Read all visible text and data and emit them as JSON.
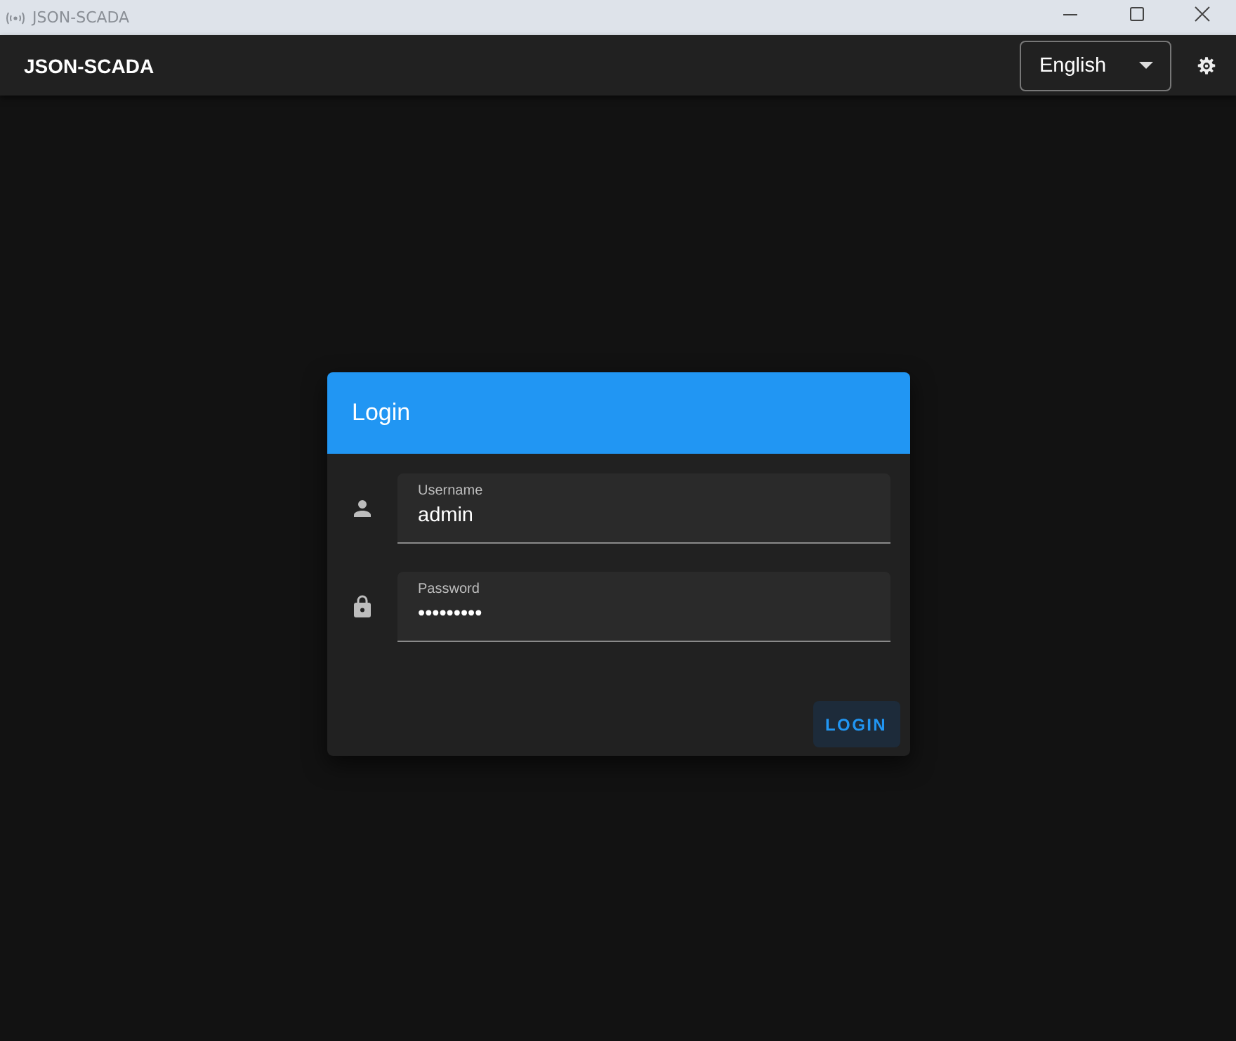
{
  "window": {
    "title": "JSON-SCADA"
  },
  "app_bar": {
    "title": "JSON-SCADA",
    "language": "English"
  },
  "login": {
    "title": "Login",
    "fields": [
      {
        "kind": "user",
        "label": "Username",
        "value": "admin"
      },
      {
        "kind": "lock",
        "label": "Password",
        "value": "•••••••••"
      }
    ],
    "button": "LOGIN"
  }
}
